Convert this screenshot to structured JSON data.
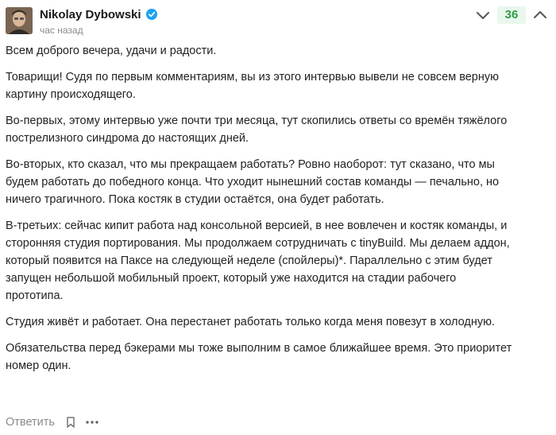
{
  "comment": {
    "author": {
      "name": "Nikolay Dybowski",
      "verified": true,
      "avatar_icon": "avatar-photo"
    },
    "timestamp": "час назад",
    "rating": "36",
    "colors": {
      "rating_text": "#2e9d45",
      "rating_bg": "#eaf7ec",
      "verified": "#1da1f2",
      "muted": "#8a8a8a"
    },
    "paragraphs": [
      "Всем доброго вечера, удачи и радости.",
      "Товарищи! Судя по первым комментариям, вы из этого интервью вывели не совсем верную картину происходящего.",
      "Во-первых, этому интервью уже почти три месяца, тут скопились ответы со времён тяжёлого пострелизного синдрома до настоящих дней.",
      "Во-вторых, кто сказал, что мы прекращаем работать? Ровно наоборот: тут сказано, что мы будем работать до победного конца. Что уходит нынешний состав команды — печально, но ничего трагичного. Пока костяк в студии остаётся, она будет работать.",
      "В-третьих: сейчас кипит работа над консольной версией, в нее вовлечен и костяк команды, и сторонняя студия портирования. Мы продолжаем сотрудничать с tinyBuild. Мы делаем аддон, который появится на Паксе на следующей неделе (спойлеры)*. Параллельно с этим будет запущен небольшой мобильный проект, который уже находится на стадии рабочего прототипа.",
      "Студия живёт и работает. Она перестанет работать только когда меня повезут в холодную.",
      "Обязательства перед бэкерами мы тоже выполним в самое ближайшее время. Это приоритет номер один."
    ],
    "footer": {
      "reply_label": "Ответить",
      "bookmark_icon": "bookmark-icon",
      "more_icon": "more-dots-icon"
    }
  }
}
